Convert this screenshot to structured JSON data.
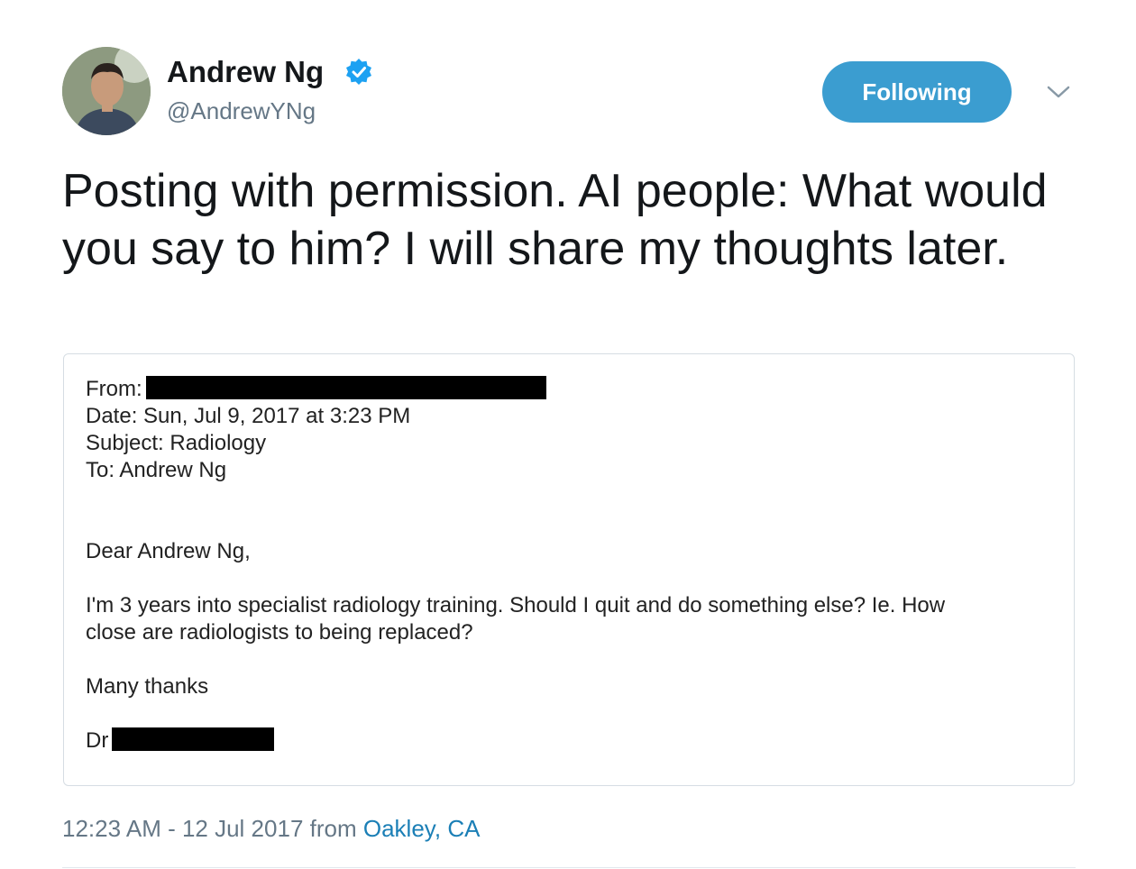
{
  "author": {
    "display_name": "Andrew Ng",
    "handle": "@AndrewYNg",
    "verified_icon": "verified-badge-icon"
  },
  "actions": {
    "follow_label": "Following",
    "menu_icon": "chevron-down-icon"
  },
  "tweet": {
    "text": "Posting with permission. AI people: What would you say to him? I will share my thoughts later."
  },
  "email": {
    "from_label": "From:",
    "date_line": "Date: Sun, Jul 9, 2017 at 3:23 PM",
    "subject_line": "Subject: Radiology",
    "to_line": "To: Andrew Ng",
    "greeting": "Dear Andrew Ng,",
    "body_line_1": "I'm 3 years into specialist radiology training. Should I quit and do something else? Ie. How",
    "body_line_2": "close are radiologists to being replaced?",
    "closing": "Many thanks",
    "signature_prefix": "Dr"
  },
  "meta": {
    "timestamp": "12:23 AM - 12 Jul 2017",
    "from_word": "from",
    "location": "Oakley, CA"
  },
  "colors": {
    "follow_button": "#3b9dd0",
    "link": "#1b7fb6",
    "secondary_text": "#657786",
    "verified": "#1da1f2"
  }
}
